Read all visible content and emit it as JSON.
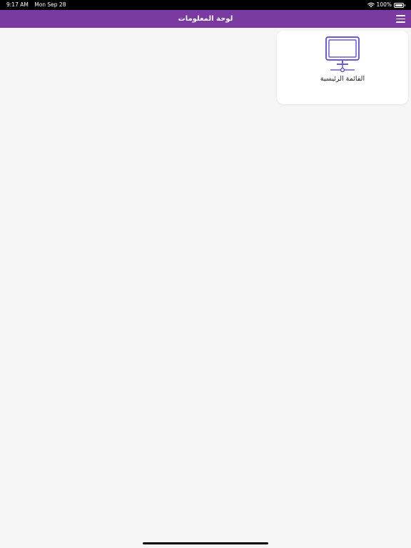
{
  "status_bar": {
    "time": "9:17 AM",
    "date": "Mon Sep 28",
    "battery": "100%",
    "wifi_icon": "wifi-icon",
    "battery_icon": "battery-full-icon"
  },
  "header": {
    "title": "لوحة المعلومات",
    "background": "#7a3a9f",
    "menu_icon": "hamburger-menu-icon"
  },
  "cards": [
    {
      "label": "القائمة الرئيسية",
      "icon": "monitor-network-icon",
      "icon_color": "#6b5bd6"
    }
  ],
  "colors": {
    "background": "#f5f5f5",
    "card": "#ffffff",
    "text": "#222222"
  }
}
